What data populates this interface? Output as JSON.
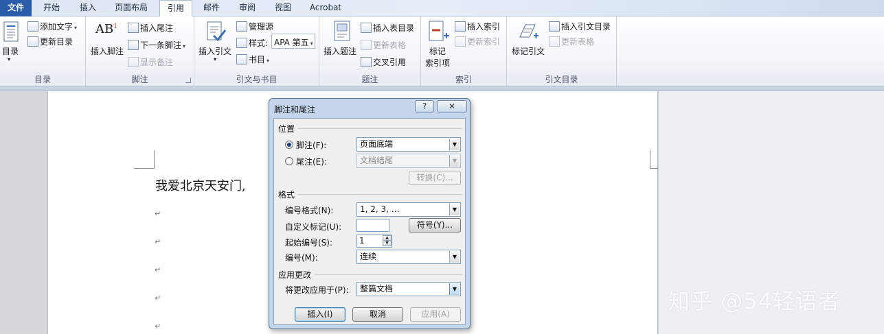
{
  "tabs": [
    "文件",
    "开始",
    "插入",
    "页面布局",
    "引用",
    "邮件",
    "审阅",
    "视图",
    "Acrobat"
  ],
  "ribbon": {
    "toc": {
      "big": "目录",
      "add_text": "添加文字",
      "update": "更新目录",
      "label": "目录"
    },
    "footnotes": {
      "insert_footnote": "插入脚注",
      "insert_endnote": "插入尾注",
      "next_footnote": "下一条脚注",
      "show_notes": "显示备注",
      "label": "脚注"
    },
    "citations": {
      "insert_citation": "插入引文",
      "manage_sources": "管理源",
      "style_label": "样式:",
      "style_value": "APA 第五",
      "bibliography": "书目",
      "label": "引文与书目"
    },
    "captions": {
      "insert_caption": "插入题注",
      "insert_tof": "插入表目录",
      "update_table": "更新表格",
      "cross_ref": "交叉引用",
      "label": "题注"
    },
    "index": {
      "mark_entry_1": "标记",
      "mark_entry_2": "索引项",
      "insert_index": "插入索引",
      "update_index": "更新索引",
      "label": "索引"
    },
    "toa": {
      "mark_citation": "标记引文",
      "insert_toa": "插入引文目录",
      "update_table": "更新表格",
      "label": "引文目录"
    }
  },
  "document": {
    "text": "我爱北京天安门,",
    "para_mark": "↵"
  },
  "dialog": {
    "title": "脚注和尾注",
    "help": "?",
    "close": "✕",
    "location_section": "位置",
    "footnote_label": "脚注(F):",
    "footnote_value": "页面底端",
    "endnote_label": "尾注(E):",
    "endnote_value": "文档结尾",
    "convert_btn": "转换(C)...",
    "format_section": "格式",
    "number_format_label": "编号格式(N):",
    "number_format_value": "1, 2, 3, …",
    "custom_mark_label": "自定义标记(U):",
    "custom_mark_value": "",
    "symbol_btn": "符号(Y)...",
    "start_at_label": "起始编号(S):",
    "start_at_value": "1",
    "numbering_label": "编号(M):",
    "numbering_value": "连续",
    "apply_section": "应用更改",
    "apply_to_label": "将更改应用于(P):",
    "apply_to_value": "整篇文档",
    "insert_btn": "插入(I)",
    "cancel_btn": "取消",
    "apply_btn": "应用(A)",
    "footnote_selected": true
  },
  "watermark": "知乎 @54轻语者",
  "colors": {
    "file_tab": "#2a5caa",
    "ribbon_bg": "#f4f6fa",
    "dialog_frame": "#c3d6ec"
  }
}
